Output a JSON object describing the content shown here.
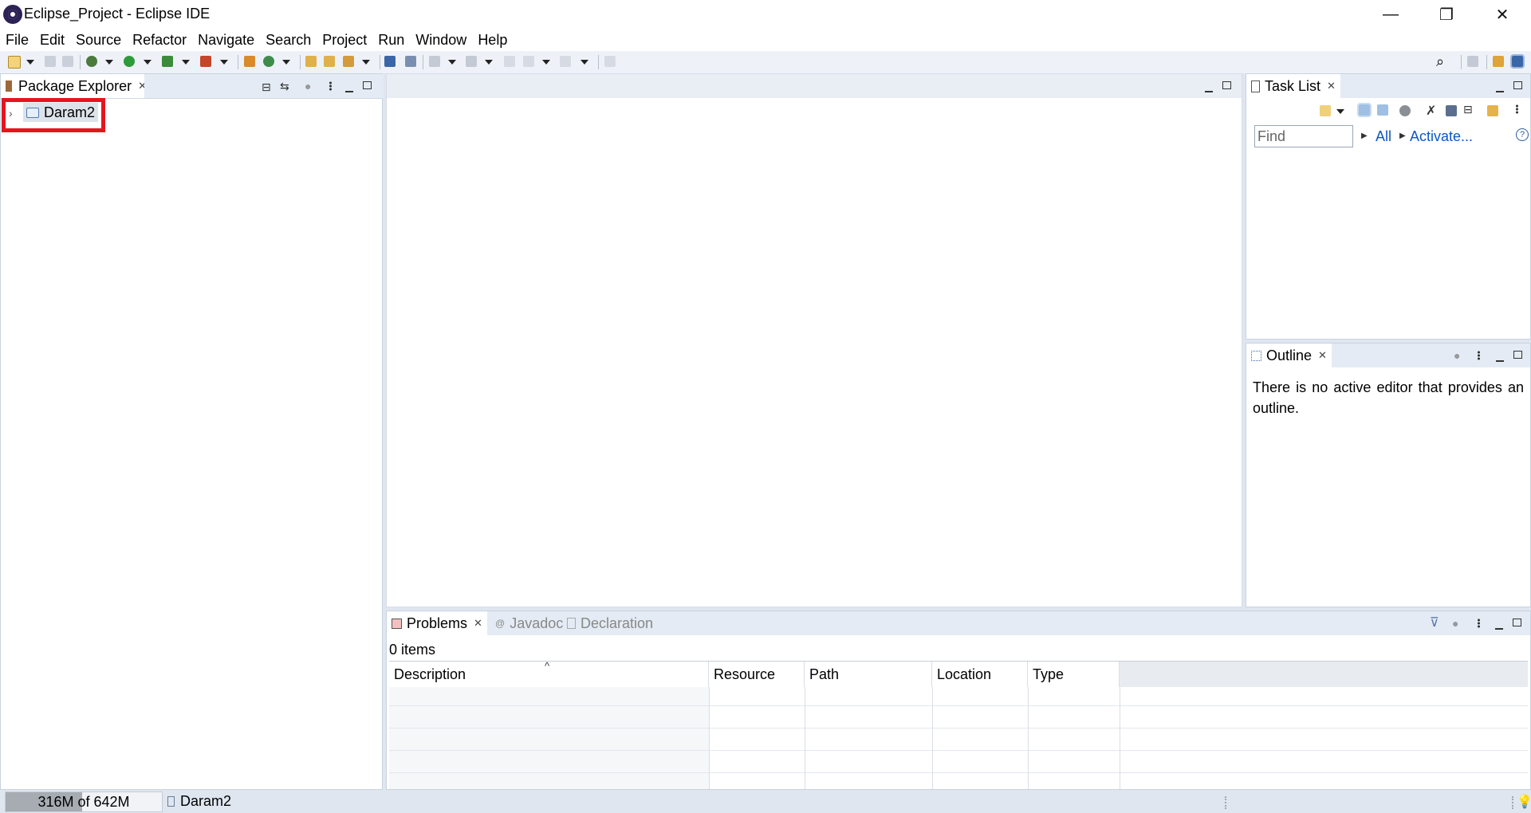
{
  "window": {
    "title": "Eclipse_Project - Eclipse IDE",
    "minimize_glyph": "—",
    "restore_glyph": "❐",
    "close_glyph": "✕"
  },
  "menu": [
    "File",
    "Edit",
    "Source",
    "Refactor",
    "Navigate",
    "Search",
    "Project",
    "Run",
    "Window",
    "Help"
  ],
  "package_explorer": {
    "tab_label": "Package Explorer",
    "items": [
      {
        "label": "Daram2",
        "expander": "›"
      }
    ]
  },
  "task_list": {
    "tab_label": "Task List",
    "find_placeholder": "Find",
    "links": [
      "All",
      "Activate..."
    ],
    "help_glyph": "?"
  },
  "outline": {
    "tab_label": "Outline",
    "message": "There is no active editor that provides an outline."
  },
  "problems": {
    "tabs": [
      "Problems",
      "Javadoc",
      "Declaration"
    ],
    "count": "0 items",
    "sort_glyph": "^",
    "columns": [
      "Description",
      "Resource",
      "Path",
      "Location",
      "Type"
    ]
  },
  "status": {
    "memory": "316M of 642M",
    "memory_used_fraction": 0.49,
    "selection": "Daram2"
  },
  "colors": {
    "highlight_box": "#e8141e",
    "link": "#0b57c8",
    "bg": "#dfe6f0"
  }
}
